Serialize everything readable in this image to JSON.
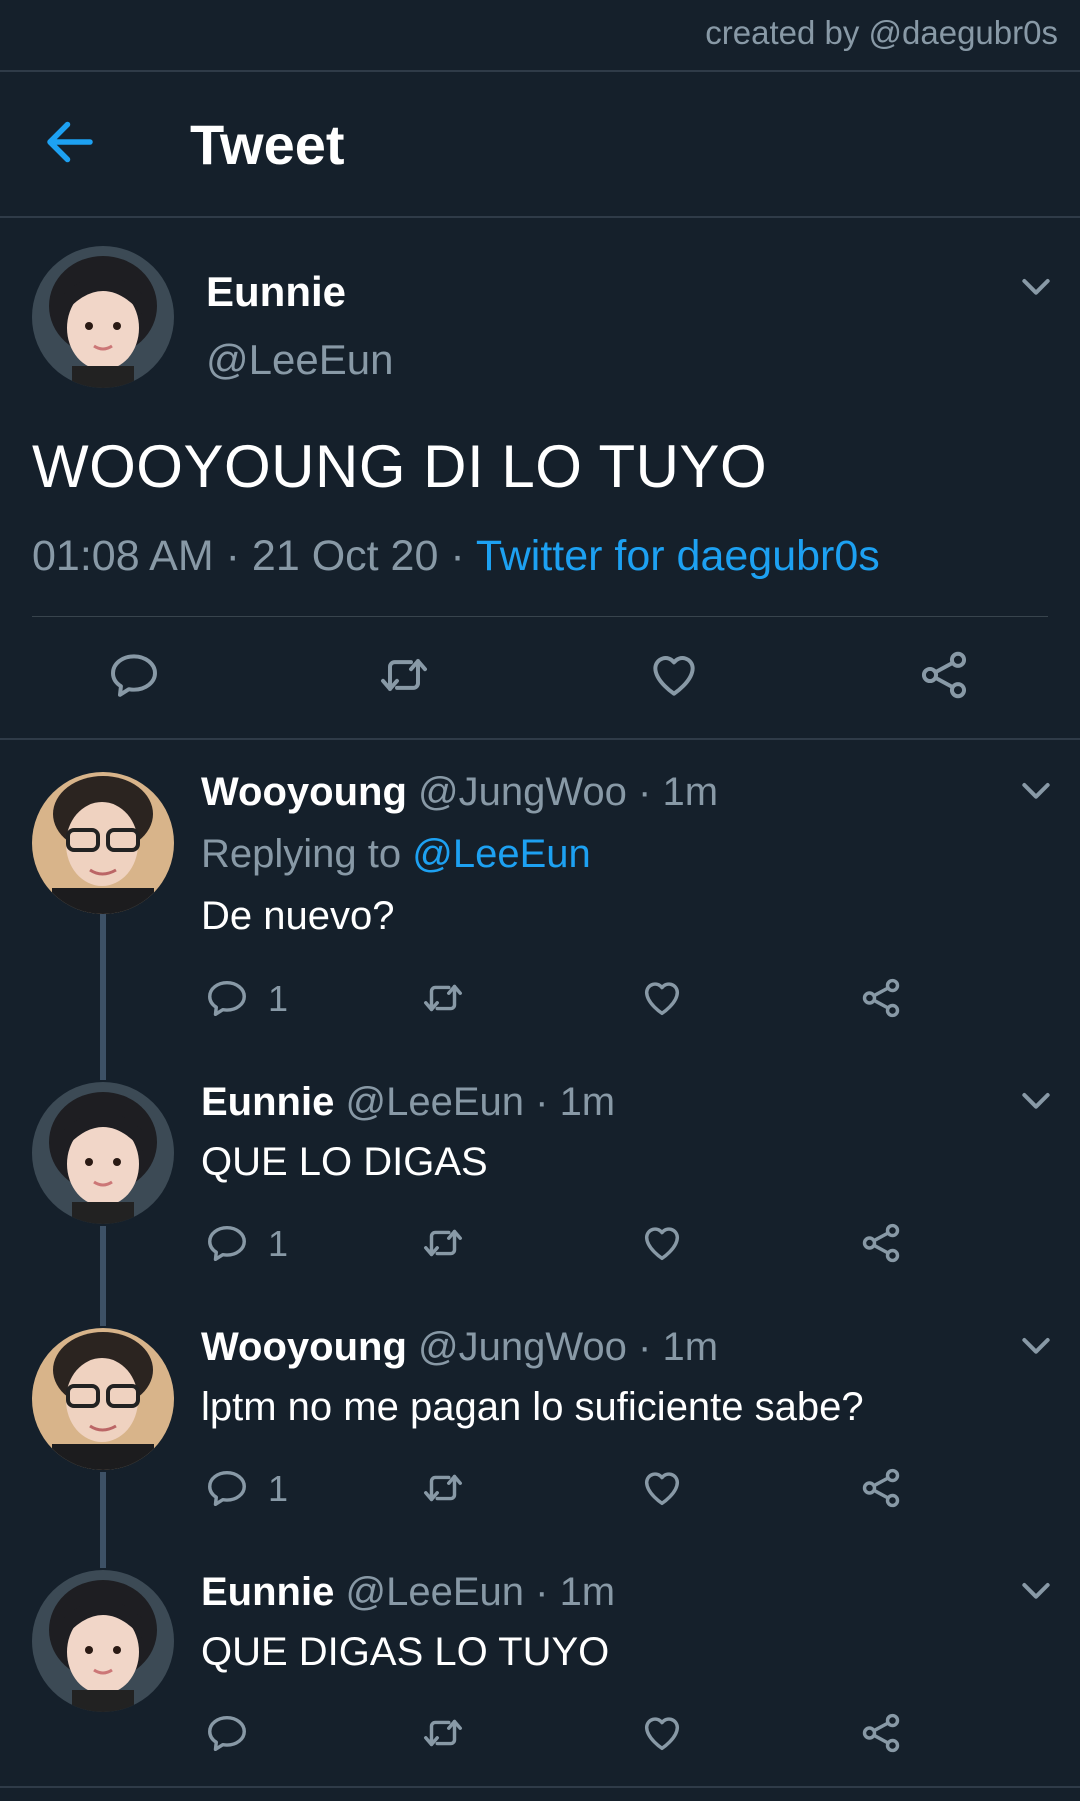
{
  "credit": "created by @daegubr0s",
  "header": {
    "title": "Tweet",
    "back_icon": "arrow-left-icon"
  },
  "colors": {
    "background": "#15202b",
    "accent": "#1da1f2",
    "secondary_text": "#8899a6",
    "divider": "#2f3b48"
  },
  "main_tweet": {
    "name": "Eunnie",
    "handle": "@LeeEun",
    "text": "WOOYOUNG DI LO TUYO",
    "time": "01:08 AM",
    "date": "21 Oct 20",
    "separator": "·",
    "source": "Twitter for daegubr0s",
    "actions": [
      "reply-icon",
      "retweet-icon",
      "like-icon",
      "share-icon"
    ]
  },
  "replies": [
    {
      "name": "Wooyoung",
      "handle": "@JungWoo",
      "sep": "·",
      "time": "1m",
      "replying_label": "Replying to",
      "replying_to": "@LeeEun",
      "text": "De nuevo?",
      "reply_count": "1"
    },
    {
      "name": "Eunnie",
      "handle": "@LeeEun",
      "sep": "·",
      "time": "1m",
      "text": "QUE LO DIGAS",
      "reply_count": "1"
    },
    {
      "name": "Wooyoung",
      "handle": "@JungWoo",
      "sep": "·",
      "time": "1m",
      "text": "lptm no me pagan lo suficiente sabe?",
      "reply_count": "1"
    },
    {
      "name": "Eunnie",
      "handle": "@LeeEun",
      "sep": "·",
      "time": "1m",
      "text": "QUE DIGAS LO TUYO",
      "reply_count": ""
    }
  ]
}
